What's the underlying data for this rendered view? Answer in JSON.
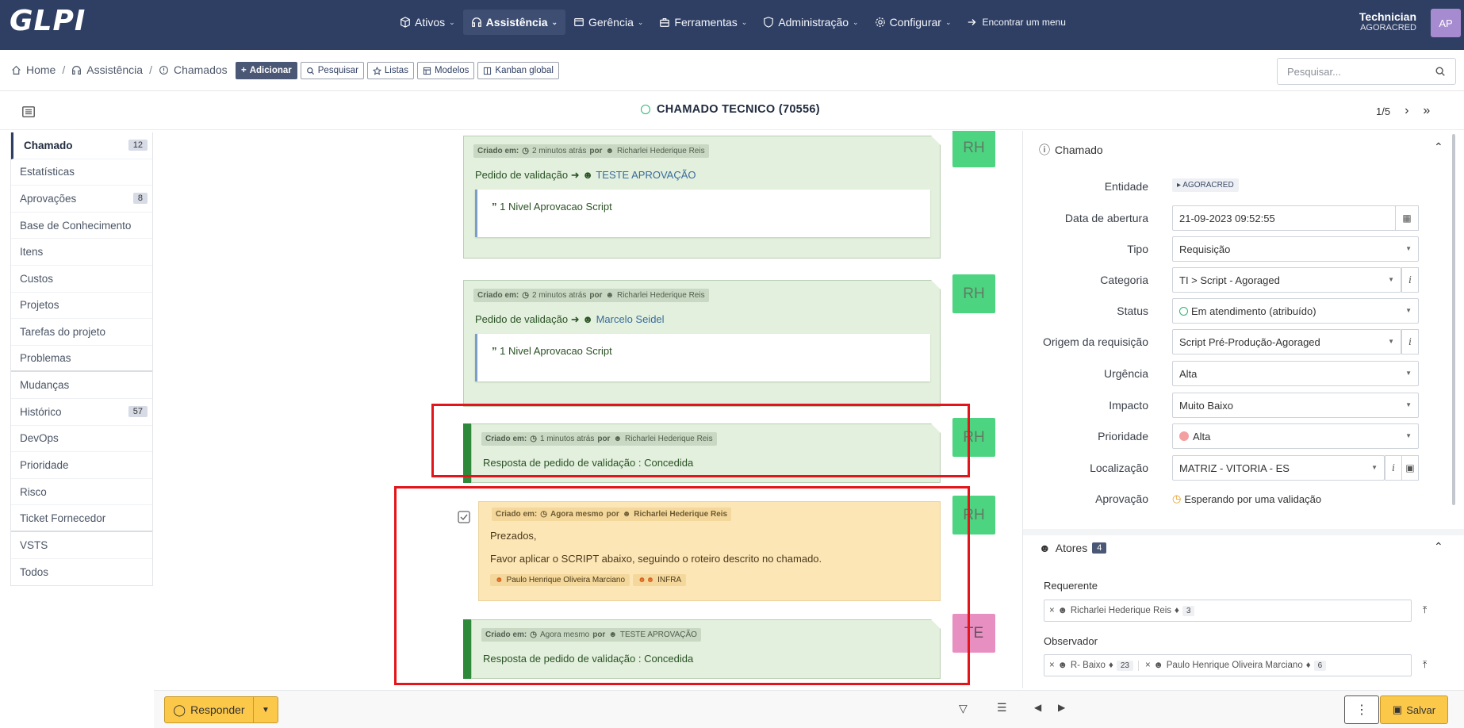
{
  "app": {
    "logo": "GLPI"
  },
  "nav": {
    "items": [
      {
        "label": "Ativos",
        "icon": "cube-icon"
      },
      {
        "label": "Assistência",
        "icon": "headset-icon",
        "active": true
      },
      {
        "label": "Gerência",
        "icon": "wallet-icon"
      },
      {
        "label": "Ferramentas",
        "icon": "briefcase-icon"
      },
      {
        "label": "Administração",
        "icon": "shield-icon"
      },
      {
        "label": "Configurar",
        "icon": "gear-icon"
      }
    ],
    "find_menu": "Encontrar um menu"
  },
  "user": {
    "name": "Technician",
    "entity": "AGORACRED",
    "initials": "AP"
  },
  "breadcrumb": {
    "home": "Home",
    "section": "Assistência",
    "page": "Chamados"
  },
  "toolbar": {
    "add": "Adicionar",
    "search": "Pesquisar",
    "lists": "Listas",
    "models": "Modelos",
    "kanban": "Kanban global",
    "search_placeholder": "Pesquisar..."
  },
  "ticket": {
    "title": "CHAMADO TECNICO (70556)",
    "pager": "1/5"
  },
  "tabs": [
    {
      "label": "Chamado",
      "count": "12",
      "active": true
    },
    {
      "label": "Estatísticas"
    },
    {
      "label": "Aprovações",
      "count": "8"
    },
    {
      "label": "Base de Conhecimento"
    },
    {
      "label": "Itens"
    },
    {
      "label": "Custos"
    },
    {
      "label": "Projetos"
    },
    {
      "label": "Tarefas do projeto"
    },
    {
      "label": "Problemas"
    },
    {
      "label": "Mudanças"
    },
    {
      "label": "Histórico",
      "count": "57"
    },
    {
      "label": "DevOps"
    },
    {
      "label": "Prioridade"
    },
    {
      "label": "Risco"
    },
    {
      "label": "Ticket Fornecedor"
    },
    {
      "label": "VSTS"
    },
    {
      "label": "Todos"
    }
  ],
  "timeline": {
    "created_label": "Criado em:",
    "by_label": "por",
    "items": [
      {
        "time": "2 minutos atrás",
        "author": "Richarlei Hederique Reis",
        "title": "Pedido de validação",
        "target": "TESTE APROVAÇÃO",
        "quote": "1 Nivel Aprovacao Script",
        "avatar": "RH"
      },
      {
        "time": "2 minutos atrás",
        "author": "Richarlei Hederique Reis",
        "title": "Pedido de validação",
        "target": "Marcelo Seidel",
        "quote": "1 Nivel Aprovacao Script",
        "avatar": "RH"
      },
      {
        "time": "1 minutos atrás",
        "author": "Richarlei Hederique Reis",
        "text": "Resposta de pedido de validação : Concedida",
        "avatar": "RH"
      },
      {
        "time": "Agora mesmo",
        "author": "Richarlei Hederique Reis",
        "line1": "Prezados,",
        "line2": "Favor aplicar o SCRIPT abaixo, seguindo o roteiro descrito no chamado.",
        "assignee": "Paulo Henrique Oliveira Marciano",
        "group": "INFRA",
        "avatar": "RH"
      },
      {
        "time": "Agora mesmo",
        "author": "TESTE APROVAÇÃO",
        "text": "Resposta de pedido de validação : Concedida",
        "avatar": "TE"
      }
    ]
  },
  "panel": {
    "section": "Chamado",
    "fields": {
      "entidade": {
        "label": "Entidade",
        "value": "AGORACRED"
      },
      "abertura": {
        "label": "Data de abertura",
        "value": "21-09-2023 09:52:55"
      },
      "tipo": {
        "label": "Tipo",
        "value": "Requisição"
      },
      "categoria": {
        "label": "Categoria",
        "value": "TI > Script - Agoraged"
      },
      "status": {
        "label": "Status",
        "value": "Em atendimento (atribuído)"
      },
      "origem": {
        "label": "Origem da requisição",
        "value": "Script Pré-Produção-Agoraged"
      },
      "urgencia": {
        "label": "Urgência",
        "value": "Alta"
      },
      "impacto": {
        "label": "Impacto",
        "value": "Muito Baixo"
      },
      "prioridade": {
        "label": "Prioridade",
        "value": "Alta"
      },
      "localizacao": {
        "label": "Localização",
        "value": "MATRIZ - VITORIA - ES"
      },
      "aprovacao": {
        "label": "Aprovação",
        "value": "Esperando por uma validação"
      }
    },
    "actors": {
      "title": "Atores",
      "count": "4",
      "requester_label": "Requerente",
      "requester": {
        "name": "Richarlei Hederique Reis",
        "count": "3"
      },
      "observer_label": "Observador",
      "observers": [
        {
          "name": "R- Baixo",
          "count": "23"
        },
        {
          "name": "Paulo Henrique Oliveira Marciano",
          "count": "6"
        }
      ]
    }
  },
  "footer": {
    "respond": "Responder",
    "save": "Salvar"
  },
  "colors": {
    "topbar": "#2f3f64",
    "validation_card": "#e2f0dd",
    "followup": "#fde6b6",
    "highlight": "#e4141b",
    "accent": "#fbc84a"
  }
}
